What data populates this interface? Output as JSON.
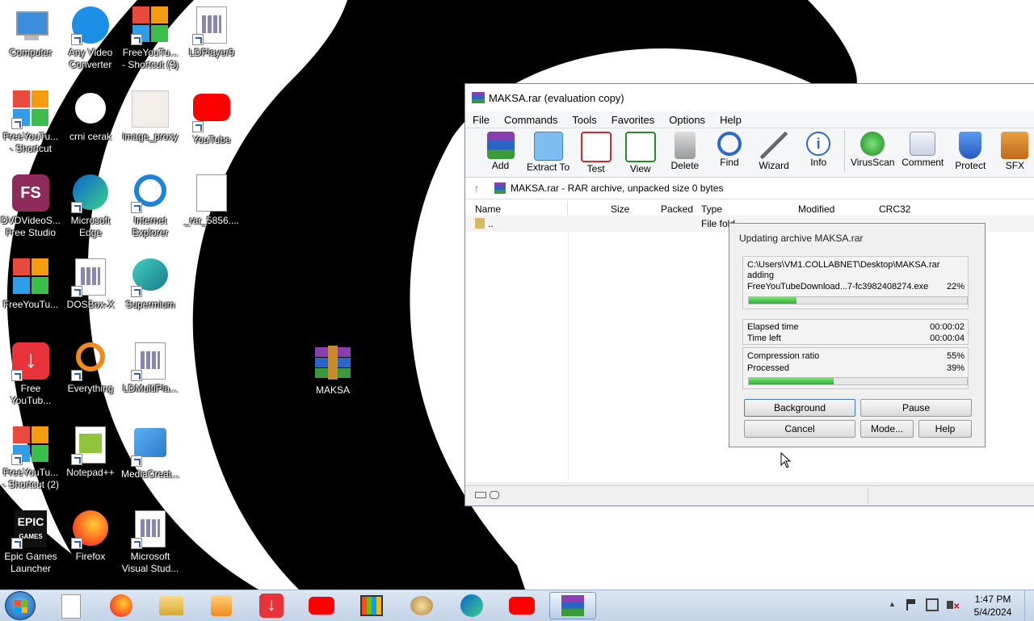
{
  "desktop_icons": [
    {
      "label": "Computer",
      "icon": "computer-icon"
    },
    {
      "label": "Any Video\nConverter",
      "icon": "any-video-converter-icon"
    },
    {
      "label": "FreeYouTu...\n- Shortcut (3)",
      "icon": "freeyoutube-icon"
    },
    {
      "label": "LDPlayer9",
      "icon": "ldplayer-icon"
    },
    {
      "label": "FreeYouTu...\n- Shortcut",
      "icon": "freeyoutube-icon"
    },
    {
      "label": "crni cerak",
      "icon": "crni-cerak-icon"
    },
    {
      "label": "image_proxy",
      "icon": "image-proxy-icon"
    },
    {
      "label": "YouTube",
      "icon": "youtube-icon"
    },
    {
      "label": "DVDVideoS...\nFree Studio",
      "icon": "dvdvideosoft-icon"
    },
    {
      "label": "Microsoft\nEdge",
      "icon": "edge-icon"
    },
    {
      "label": "Internet\nExplorer",
      "icon": "ie-icon"
    },
    {
      "label": "_rar_5856....",
      "icon": "file-icon"
    },
    {
      "label": "FreeYouTu...",
      "icon": "freeyoutube-icon"
    },
    {
      "label": "DOSBox-X",
      "icon": "dosbox-icon"
    },
    {
      "label": "Supermium",
      "icon": "supermium-icon"
    },
    {
      "label": "Free\nYouTub...",
      "icon": "free-youtube-download-icon"
    },
    {
      "label": "Everything",
      "icon": "everything-icon"
    },
    {
      "label": "LDMultiPla...",
      "icon": "ldmultiplayer-icon"
    },
    {
      "label": "FreeYouTu...\n- Shortcut (2)",
      "icon": "freeyoutube-icon"
    },
    {
      "label": "Notepad++",
      "icon": "notepadpp-icon"
    },
    {
      "label": "MediaCreat...",
      "icon": "mediacreation-icon"
    },
    {
      "label": "Epic Games\nLauncher",
      "icon": "epic-games-icon"
    },
    {
      "label": "Firefox",
      "icon": "firefox-icon"
    },
    {
      "label": "Microsoft\nVisual Stud...",
      "icon": "visual-studio-icon"
    },
    {
      "label": "MAKSA",
      "icon": "winrar-archive-icon"
    }
  ],
  "window": {
    "title": "MAKSA.rar (evaluation copy)",
    "menu": [
      "File",
      "Commands",
      "Tools",
      "Favorites",
      "Options",
      "Help"
    ],
    "toolbar": [
      {
        "label": "Add",
        "icon": "add-icon"
      },
      {
        "label": "Extract To",
        "icon": "extract-icon"
      },
      {
        "label": "Test",
        "icon": "test-icon"
      },
      {
        "label": "View",
        "icon": "view-icon"
      },
      {
        "label": "Delete",
        "icon": "delete-icon"
      },
      {
        "label": "Find",
        "icon": "find-icon"
      },
      {
        "label": "Wizard",
        "icon": "wizard-icon"
      },
      {
        "label": "Info",
        "icon": "info-icon"
      },
      {
        "label": "VirusScan",
        "icon": "virusscan-icon"
      },
      {
        "label": "Comment",
        "icon": "comment-icon"
      },
      {
        "label": "Protect",
        "icon": "protect-icon"
      },
      {
        "label": "SFX",
        "icon": "sfx-icon"
      }
    ],
    "path": "MAKSA.rar - RAR archive, unpacked size 0 bytes",
    "columns": [
      "Name",
      "Size",
      "Packed",
      "Type",
      "Modified",
      "CRC32"
    ],
    "rows": [
      {
        "name": "..",
        "type": "File fold"
      }
    ]
  },
  "dialog": {
    "title": "Updating archive MAKSA.rar",
    "archive_path": "C:\\Users\\VM1.COLLABNET\\Desktop\\MAKSA.rar",
    "action": "adding",
    "current_file": "FreeYouTubeDownload...7-fc3982408274.exe",
    "file_percent": "22%",
    "file_progress": 0.22,
    "elapsed_label": "Elapsed time",
    "elapsed_value": "00:00:02",
    "timeleft_label": "Time left",
    "timeleft_value": "00:00:04",
    "ratio_label": "Compression ratio",
    "ratio_value": "55%",
    "processed_label": "Processed",
    "processed_value": "39%",
    "processed_progress": 0.39,
    "buttons": {
      "background": "Background",
      "pause": "Pause",
      "cancel": "Cancel",
      "mode": "Mode...",
      "help": "Help"
    }
  },
  "taskbar": {
    "time": "1:47 PM",
    "date": "5/4/2024"
  }
}
